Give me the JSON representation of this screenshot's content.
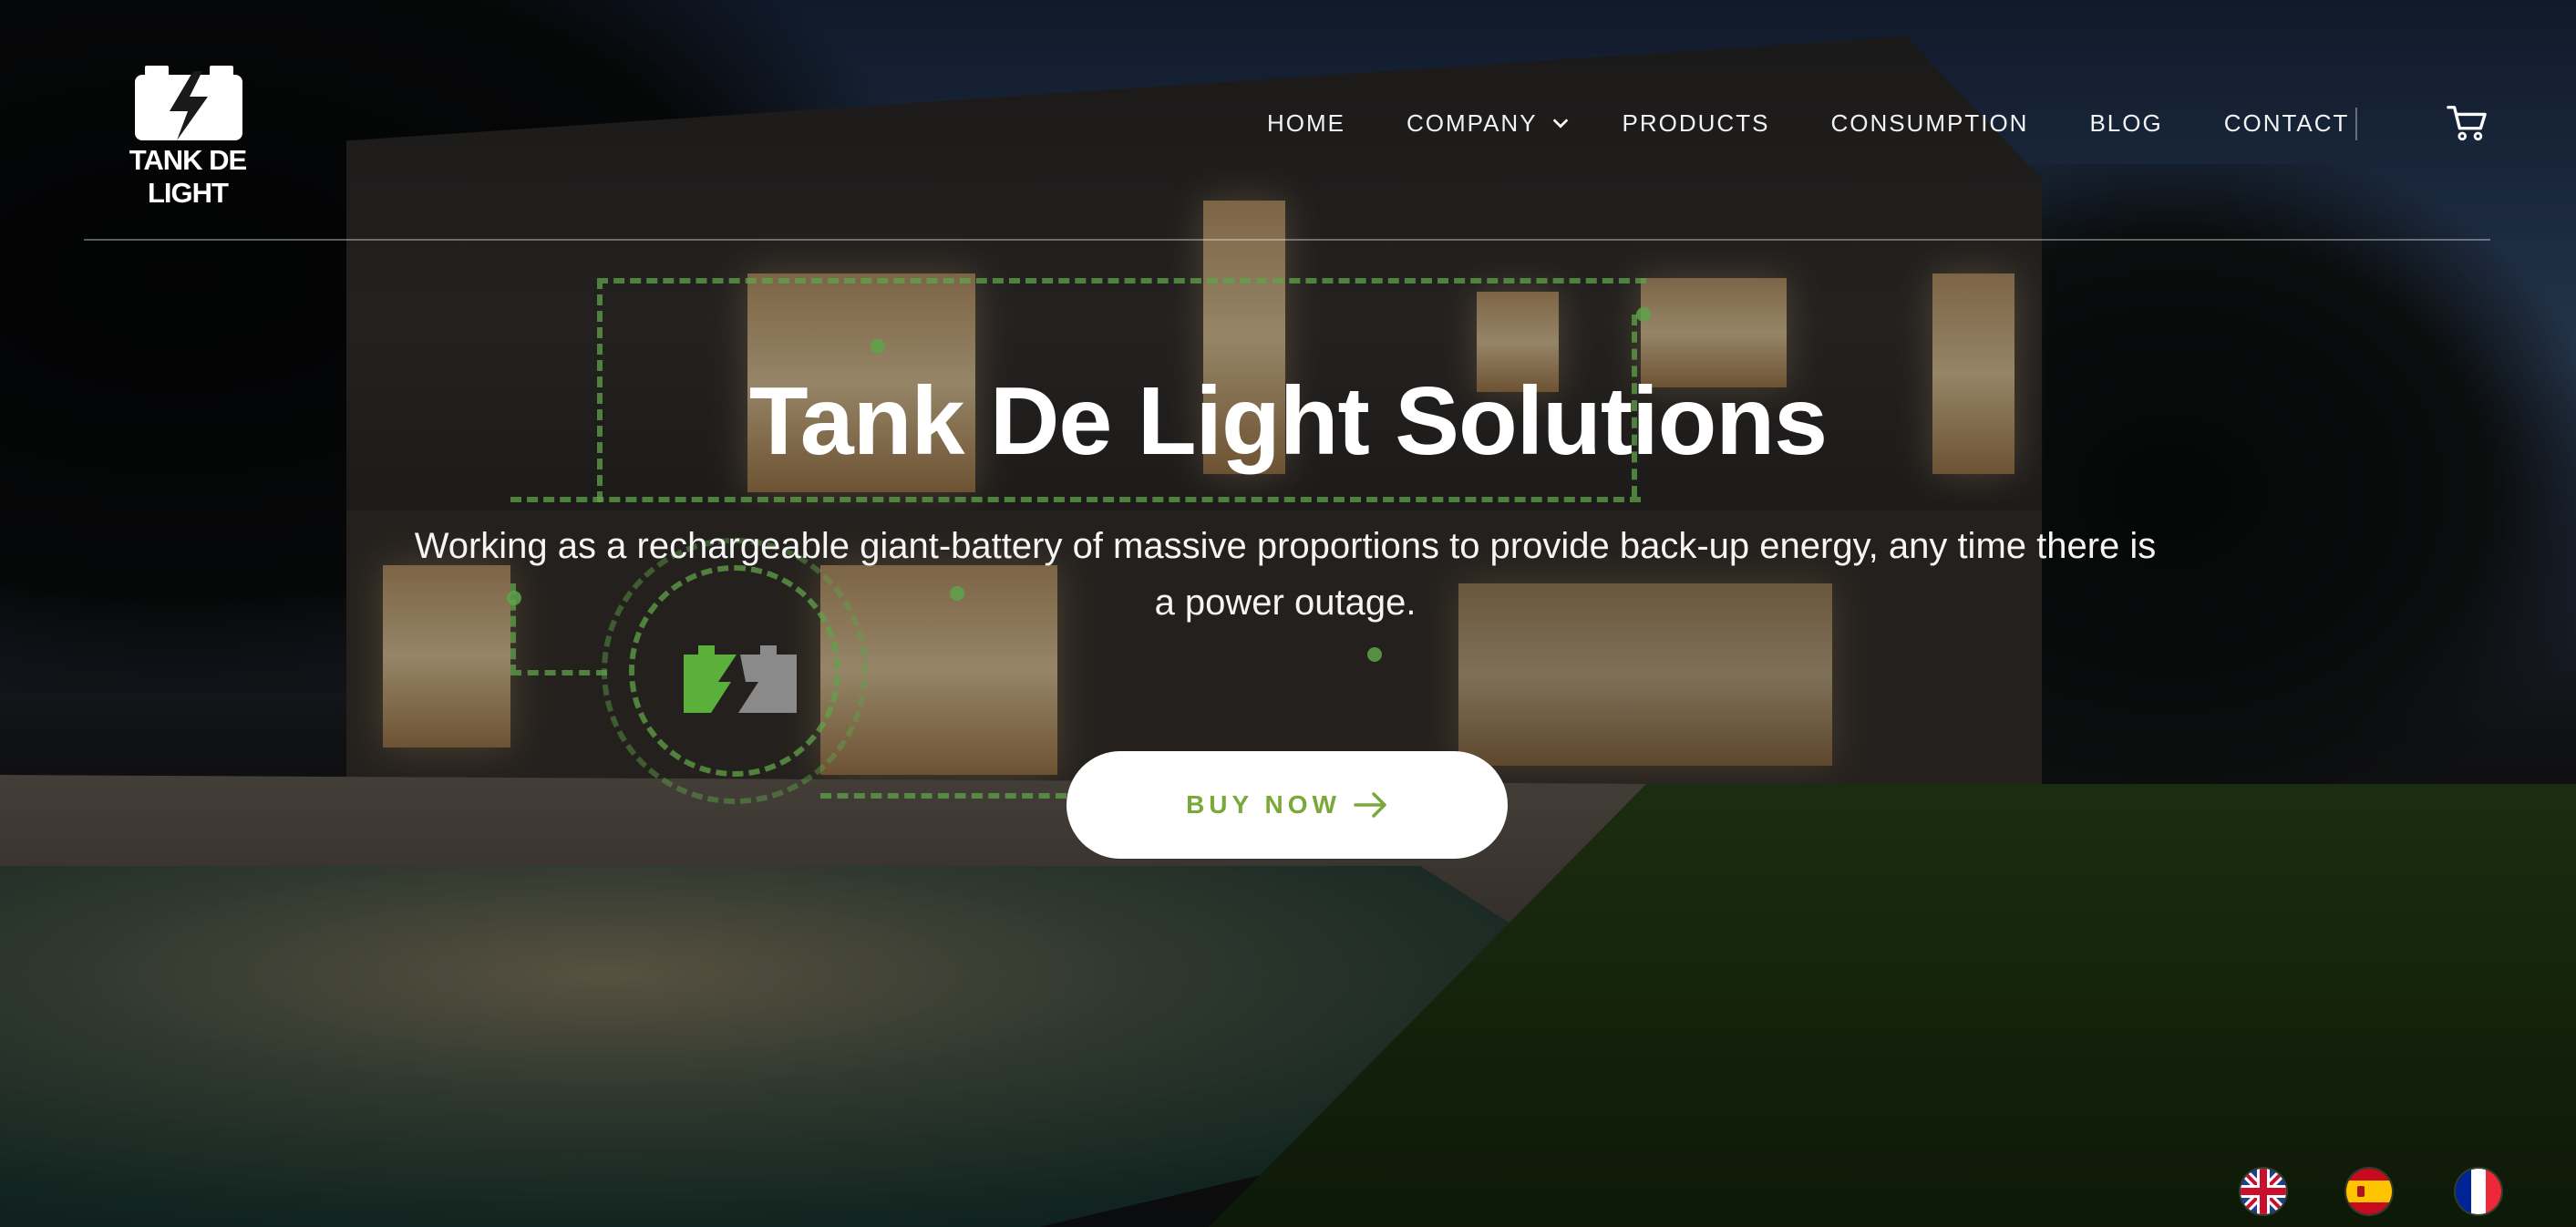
{
  "brand": {
    "logo_text": "TANK DE LIGHT"
  },
  "nav": {
    "items": [
      {
        "label": "HOME"
      },
      {
        "label": "COMPANY",
        "has_dropdown": true
      },
      {
        "label": "PRODUCTS"
      },
      {
        "label": "CONSUMPTION"
      },
      {
        "label": "BLOG"
      },
      {
        "label": "CONTACT"
      }
    ],
    "cart_icon": "shopping-cart-icon"
  },
  "hero": {
    "title": "Tank De Light Solutions",
    "subtitle": "Working as a rechargeable giant-battery of massive proportions to provide back-up energy, any time there is a power outage.",
    "cta_label": "BUY NOW",
    "cta_icon": "arrow-right-icon"
  },
  "languages": [
    {
      "code": "en",
      "icon": "uk-flag-icon"
    },
    {
      "code": "es",
      "icon": "spain-flag-icon"
    },
    {
      "code": "fr",
      "icon": "france-flag-icon"
    }
  ],
  "colors": {
    "accent_green": "#7aa93a",
    "illustration_green": "#5fa34a",
    "text": "#ffffff"
  }
}
